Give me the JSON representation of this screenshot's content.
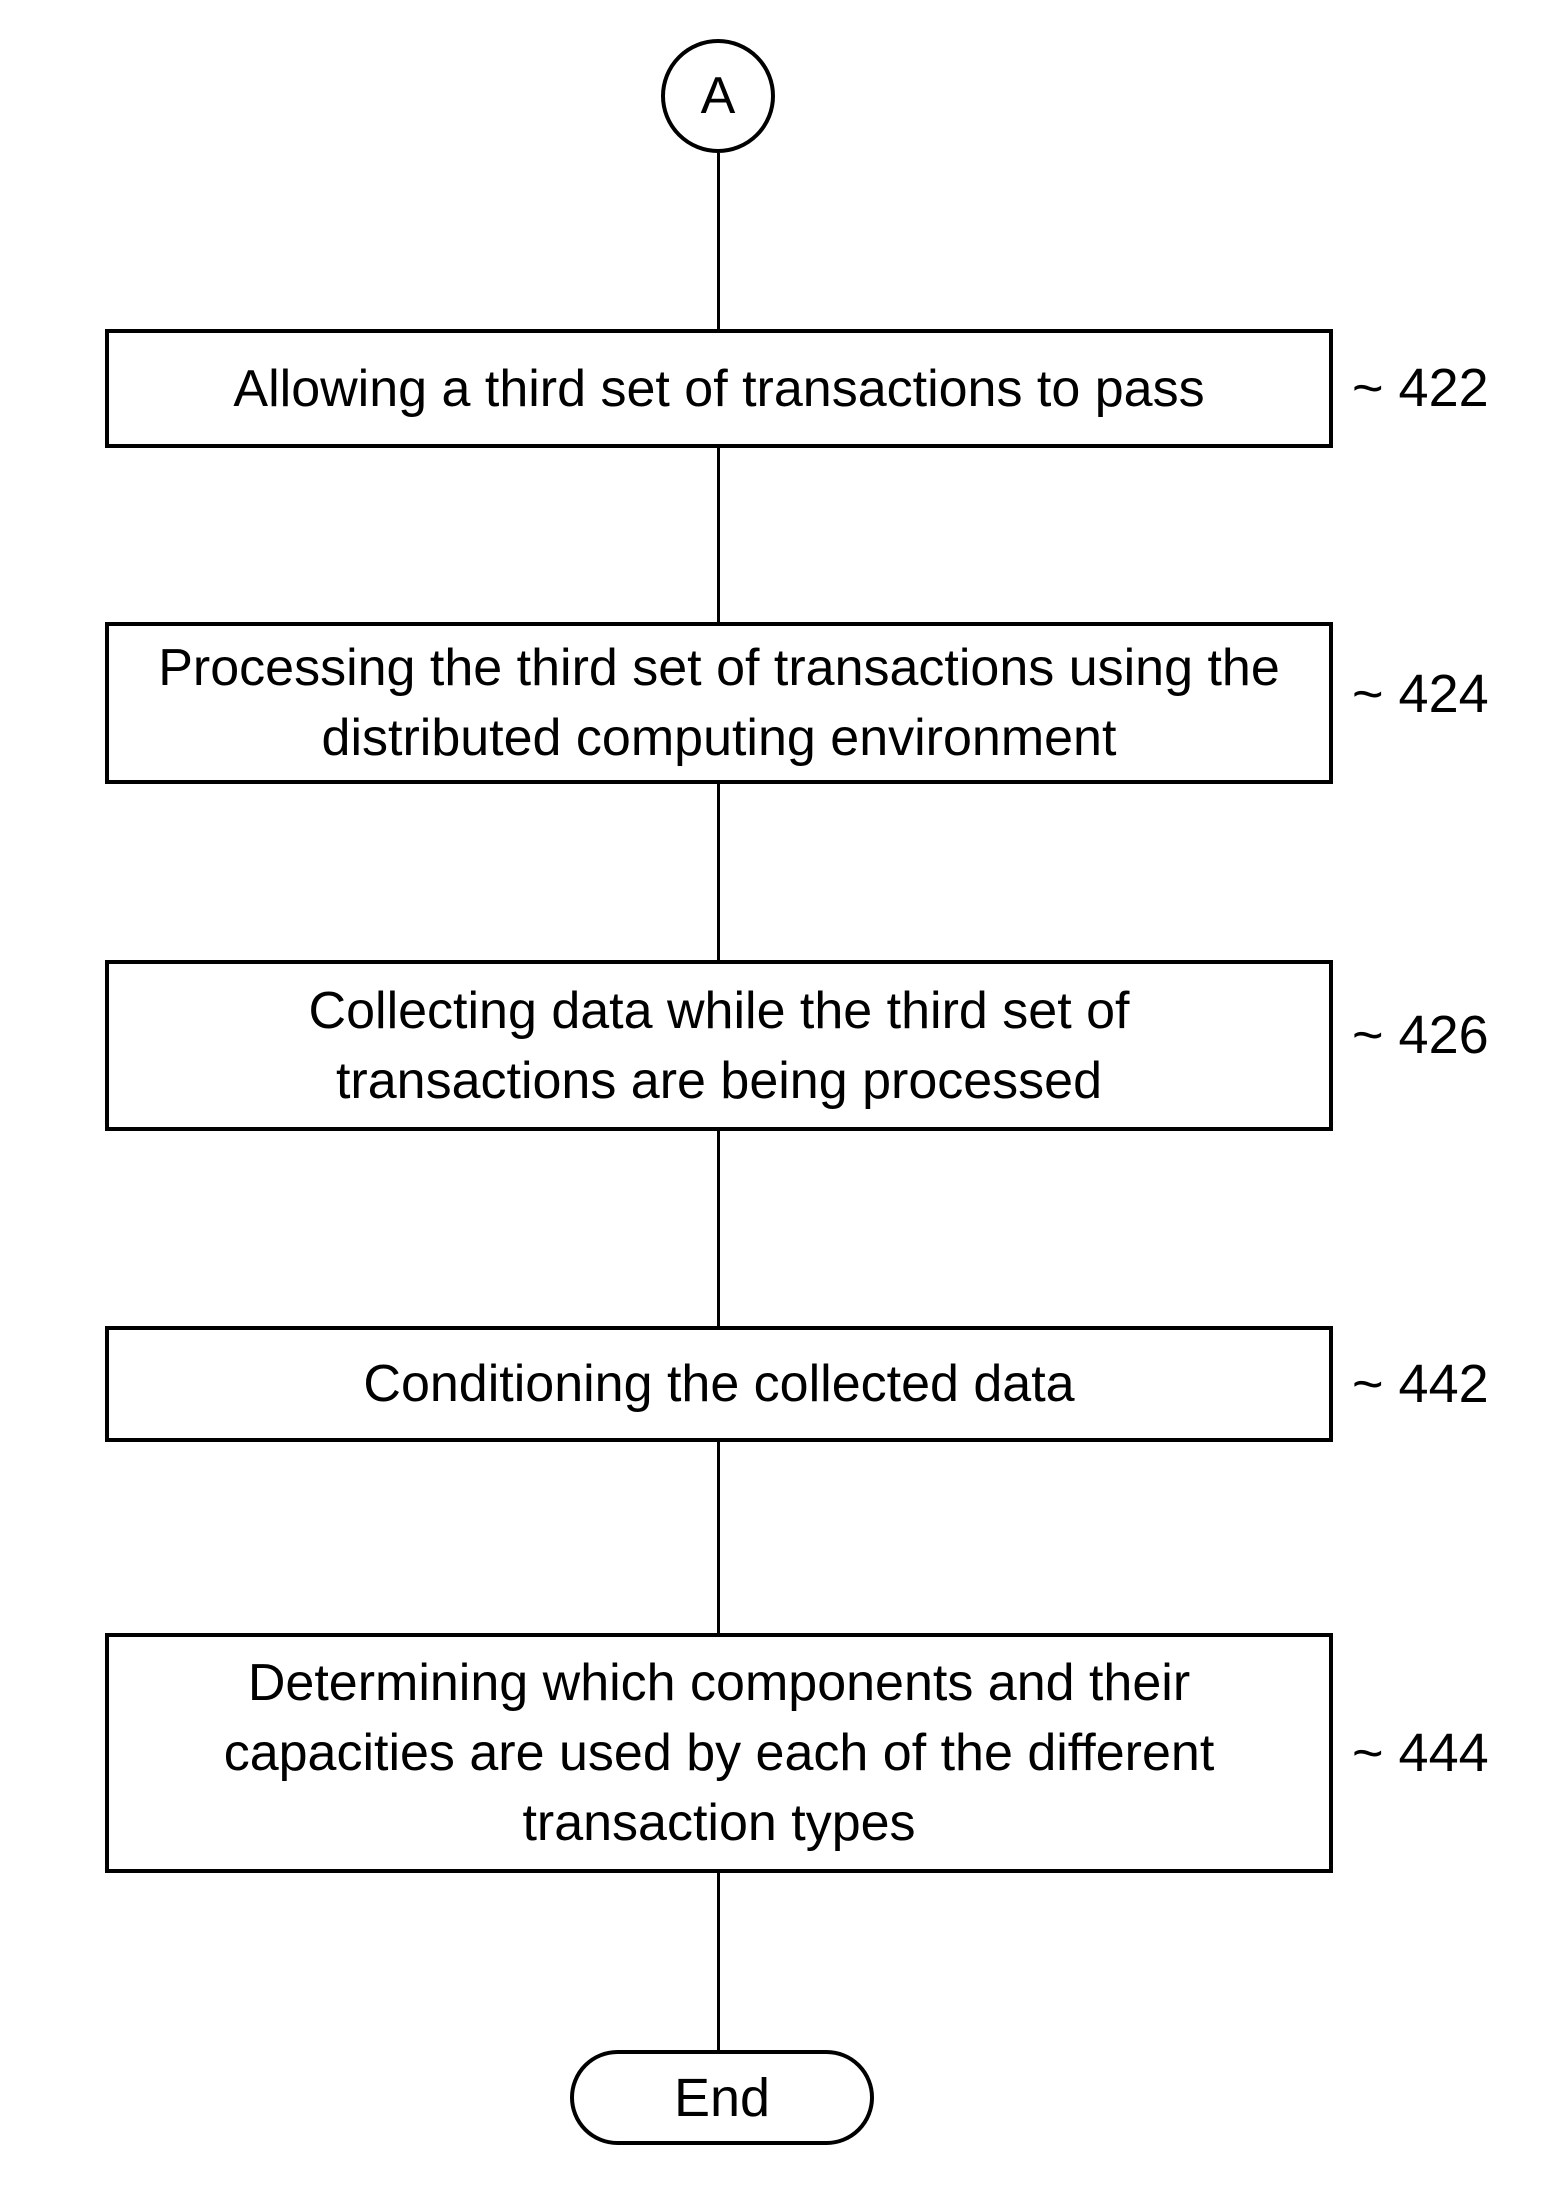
{
  "connector": {
    "label": "A"
  },
  "steps": [
    {
      "text": "Allowing a third set of transactions to pass",
      "ref": "~ 422"
    },
    {
      "text": "Processing the third set of transactions using the distributed computing environment",
      "ref": "~ 424"
    },
    {
      "text": "Collecting data while the third set of transactions are being processed",
      "ref": "~ 426"
    },
    {
      "text": "Conditioning the collected data",
      "ref": "~ 442"
    },
    {
      "text": "Determining which components and their capacities are used by each of the different transaction types",
      "ref": "~ 444"
    }
  ],
  "terminator": {
    "label": "End"
  }
}
